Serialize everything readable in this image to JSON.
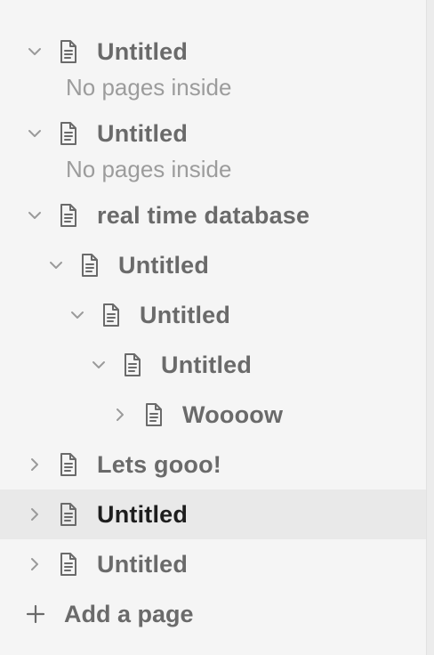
{
  "tree": {
    "items": [
      {
        "label": "Untitled",
        "expanded": true,
        "depth": 0,
        "empty_text": "No pages inside"
      },
      {
        "label": "Untitled",
        "expanded": true,
        "depth": 0,
        "empty_text": "No pages inside"
      },
      {
        "label": "real time database",
        "expanded": true,
        "depth": 0
      },
      {
        "label": "Untitled",
        "expanded": true,
        "depth": 1
      },
      {
        "label": "Untitled",
        "expanded": true,
        "depth": 2
      },
      {
        "label": "Untitled",
        "expanded": true,
        "depth": 3
      },
      {
        "label": "Woooow",
        "expanded": false,
        "depth": 4
      },
      {
        "label": "Lets gooo!",
        "expanded": false,
        "depth": 0
      },
      {
        "label": "Untitled",
        "expanded": false,
        "depth": 0,
        "selected": true
      },
      {
        "label": "Untitled",
        "expanded": false,
        "depth": 0
      }
    ],
    "add_page_label": "Add a page"
  },
  "icons": {
    "expanded": "chevron-down-icon",
    "collapsed": "chevron-right-icon",
    "page": "page-icon",
    "add": "plus-icon"
  },
  "colors": {
    "background": "#f5f5f5",
    "selected_row": "#e9e9e9",
    "text": "#6a6a6a",
    "selected_text": "#1e1e1e",
    "muted_text": "#9c9c9c"
  }
}
